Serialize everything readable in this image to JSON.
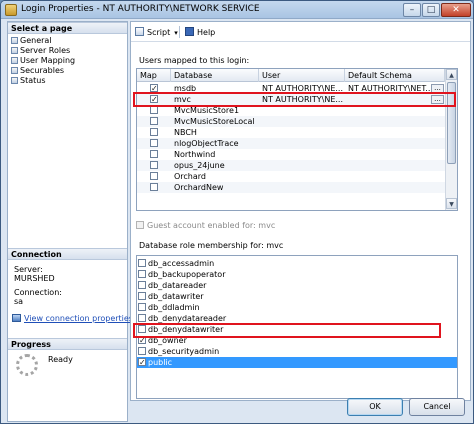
{
  "window": {
    "title": "Login Properties - NT AUTHORITY\\NETWORK SERVICE",
    "minimize_glyph": "–",
    "maximize_glyph": "□",
    "close_glyph": "✕"
  },
  "left_pane": {
    "select_page_header": "Select a page",
    "pages": [
      {
        "label": "General"
      },
      {
        "label": "Server Roles"
      },
      {
        "label": "User Mapping"
      },
      {
        "label": "Securables"
      },
      {
        "label": "Status"
      }
    ],
    "connection": {
      "header": "Connection",
      "server_label": "Server:",
      "server_value": "MURSHED",
      "connection_label": "Connection:",
      "connection_value": "sa",
      "link_text": "View connection properties"
    },
    "progress": {
      "header": "Progress",
      "status": "Ready"
    }
  },
  "toolbar": {
    "script_label": "Script",
    "script_caret": "▾",
    "help_label": "Help"
  },
  "users_mapped": {
    "label": "Users mapped to this login:",
    "columns": [
      "Map",
      "Database",
      "User",
      "Default Schema"
    ],
    "ellipsis": "...",
    "check_glyph": "✓",
    "rows": [
      {
        "checked": true,
        "database": "msdb",
        "user": "NT AUTHORITY\\NE...",
        "schema": "NT AUTHORITY\\NET..."
      },
      {
        "checked": true,
        "database": "mvc",
        "user": "NT AUTHORITY\\NE...",
        "schema": ""
      },
      {
        "checked": false,
        "database": "MvcMusicStore1",
        "user": "",
        "schema": ""
      },
      {
        "checked": false,
        "database": "MvcMusicStoreLocal",
        "user": "",
        "schema": ""
      },
      {
        "checked": false,
        "database": "NBCH",
        "user": "",
        "schema": ""
      },
      {
        "checked": false,
        "database": "nlogObjectTrace",
        "user": "",
        "schema": ""
      },
      {
        "checked": false,
        "database": "Northwind",
        "user": "",
        "schema": ""
      },
      {
        "checked": false,
        "database": "opus_24june",
        "user": "",
        "schema": ""
      },
      {
        "checked": false,
        "database": "Orchard",
        "user": "",
        "schema": ""
      },
      {
        "checked": false,
        "database": "OrchardNew",
        "user": "",
        "schema": ""
      }
    ],
    "scroll_up_glyph": "▲",
    "scroll_down_glyph": "▼"
  },
  "guest": {
    "label": "Guest account enabled for: mvc"
  },
  "roles": {
    "label": "Database role membership for: mvc",
    "items": [
      {
        "name": "db_accessadmin",
        "checked": false
      },
      {
        "name": "db_backupoperator",
        "checked": false
      },
      {
        "name": "db_datareader",
        "checked": false
      },
      {
        "name": "db_datawriter",
        "checked": false
      },
      {
        "name": "db_ddladmin",
        "checked": false
      },
      {
        "name": "db_denydatareader",
        "checked": false
      },
      {
        "name": "db_denydatawriter",
        "checked": false
      },
      {
        "name": "db_owner",
        "checked": true
      },
      {
        "name": "db_securityadmin",
        "checked": false
      },
      {
        "name": "public",
        "checked": true
      }
    ],
    "selected": "public"
  },
  "buttons": {
    "ok": "OK",
    "cancel": "Cancel"
  },
  "colors": {
    "selection": "#3399ff",
    "highlight_box": "#e0141e",
    "link": "#1f4fb8"
  }
}
